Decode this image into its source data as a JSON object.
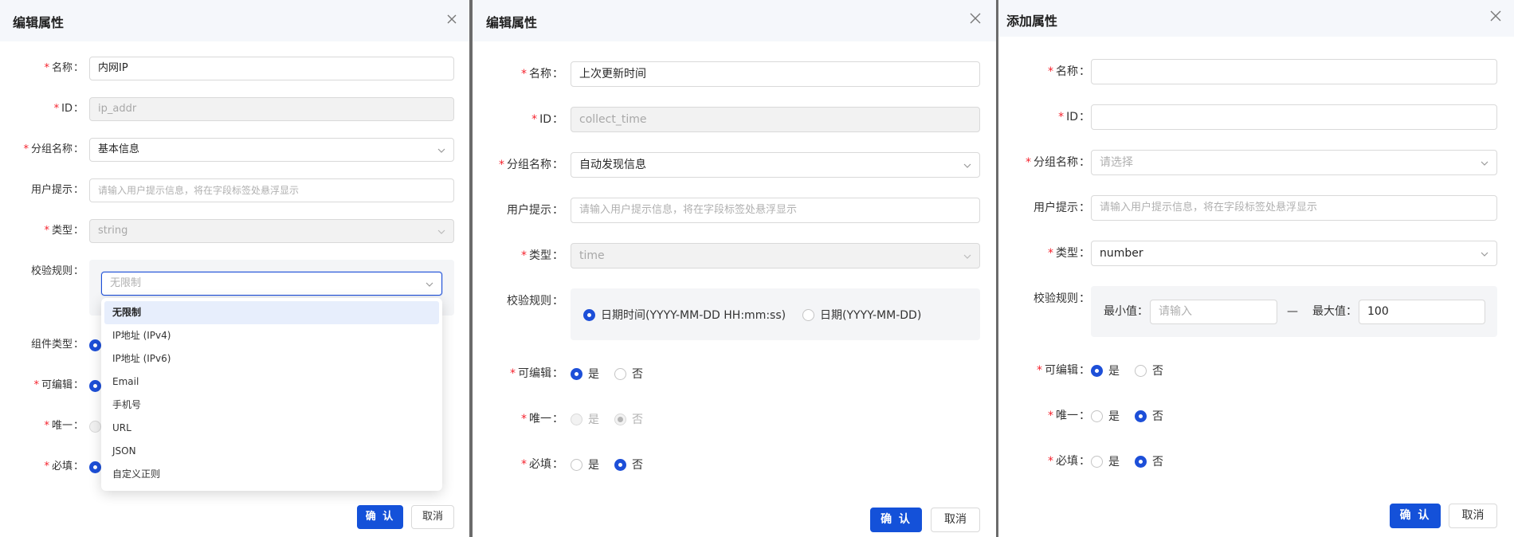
{
  "req": "*",
  "colon": "：",
  "panel1": {
    "title": "编辑属性",
    "name_label": "名称",
    "name_value": "内网IP",
    "id_label": "ID",
    "id_value": "ip_addr",
    "group_label": "分组名称",
    "group_value": "基本信息",
    "hint_label": "用户提示",
    "hint_placeholder": "请输入用户提示信息，将在字段标签处悬浮显示",
    "type_label": "类型",
    "type_value": "string",
    "rule_label": "校验规则",
    "rule_value": "无限制",
    "component_label": "组件类型",
    "editable_label": "可编辑",
    "unique_label": "唯一",
    "required_label": "必填",
    "dropdown_items": [
      "无限制",
      "IP地址 (IPv4)",
      "IP地址 (IPv6)",
      "Email",
      "手机号",
      "URL",
      "JSON",
      "自定义正则"
    ],
    "confirm": "确 认",
    "cancel": "取消"
  },
  "panel2": {
    "title": "编辑属性",
    "name_label": "名称",
    "name_value": "上次更新时间",
    "id_label": "ID",
    "id_value": "collect_time",
    "group_label": "分组名称",
    "group_value": "自动发现信息",
    "hint_label": "用户提示",
    "hint_placeholder": "请输入用户提示信息，将在字段标签处悬浮显示",
    "type_label": "类型",
    "type_value": "time",
    "rule_label": "校验规则",
    "rule_opt1": "日期时间(YYYY-MM-DD HH:mm:ss)",
    "rule_opt2": "日期(YYYY-MM-DD)",
    "editable_label": "可编辑",
    "unique_label": "唯一",
    "required_label": "必填",
    "yes": "是",
    "no": "否",
    "confirm": "确 认",
    "cancel": "取消"
  },
  "panel3": {
    "title": "添加属性",
    "name_label": "名称",
    "id_label": "ID",
    "group_label": "分组名称",
    "group_placeholder": "请选择",
    "hint_label": "用户提示",
    "hint_placeholder": "请输入用户提示信息，将在字段标签处悬浮显示",
    "type_label": "类型",
    "type_value": "number",
    "rule_label": "校验规则",
    "min_label": "最小值：",
    "min_placeholder": "请输入",
    "dash": "—",
    "max_label": "最大值：",
    "max_value": "100",
    "editable_label": "可编辑",
    "unique_label": "唯一",
    "required_label": "必填",
    "yes": "是",
    "no": "否",
    "confirm": "确 认",
    "cancel": "取消"
  },
  "colors": {
    "primary": "#1451d9",
    "required": "#f5222d",
    "header_bg": "#f5f7fb"
  },
  "icons": [
    "close-icon",
    "chevron-down-icon"
  ]
}
